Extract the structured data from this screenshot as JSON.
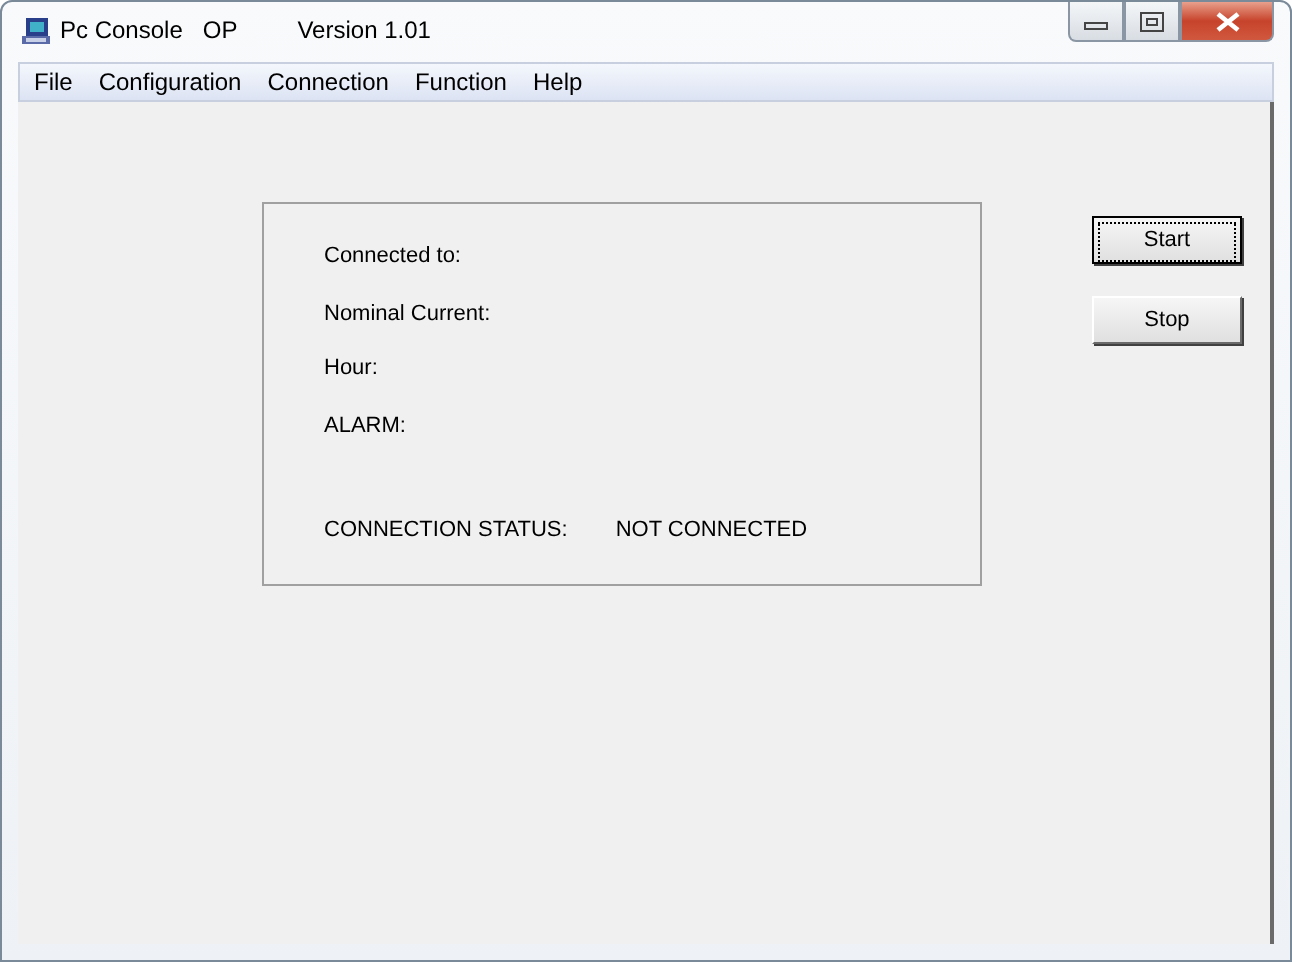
{
  "window": {
    "title": "Pc Console",
    "title_parts": [
      "OP",
      "Version 1.01"
    ]
  },
  "menu": [
    "File",
    "Configuration",
    "Connection",
    "Function",
    "Help"
  ],
  "status_panel": {
    "fields": [
      {
        "label": "Connected to:"
      },
      {
        "label": "Nominal Current:"
      },
      {
        "label": "Hour:"
      },
      {
        "label": "ALARM:"
      }
    ],
    "connection": {
      "label": "CONNECTION STATUS:",
      "value": "NOT CONNECTED"
    }
  },
  "buttons": [
    {
      "label": "Start",
      "focused": true
    },
    {
      "label": "Stop",
      "focused": false
    }
  ]
}
